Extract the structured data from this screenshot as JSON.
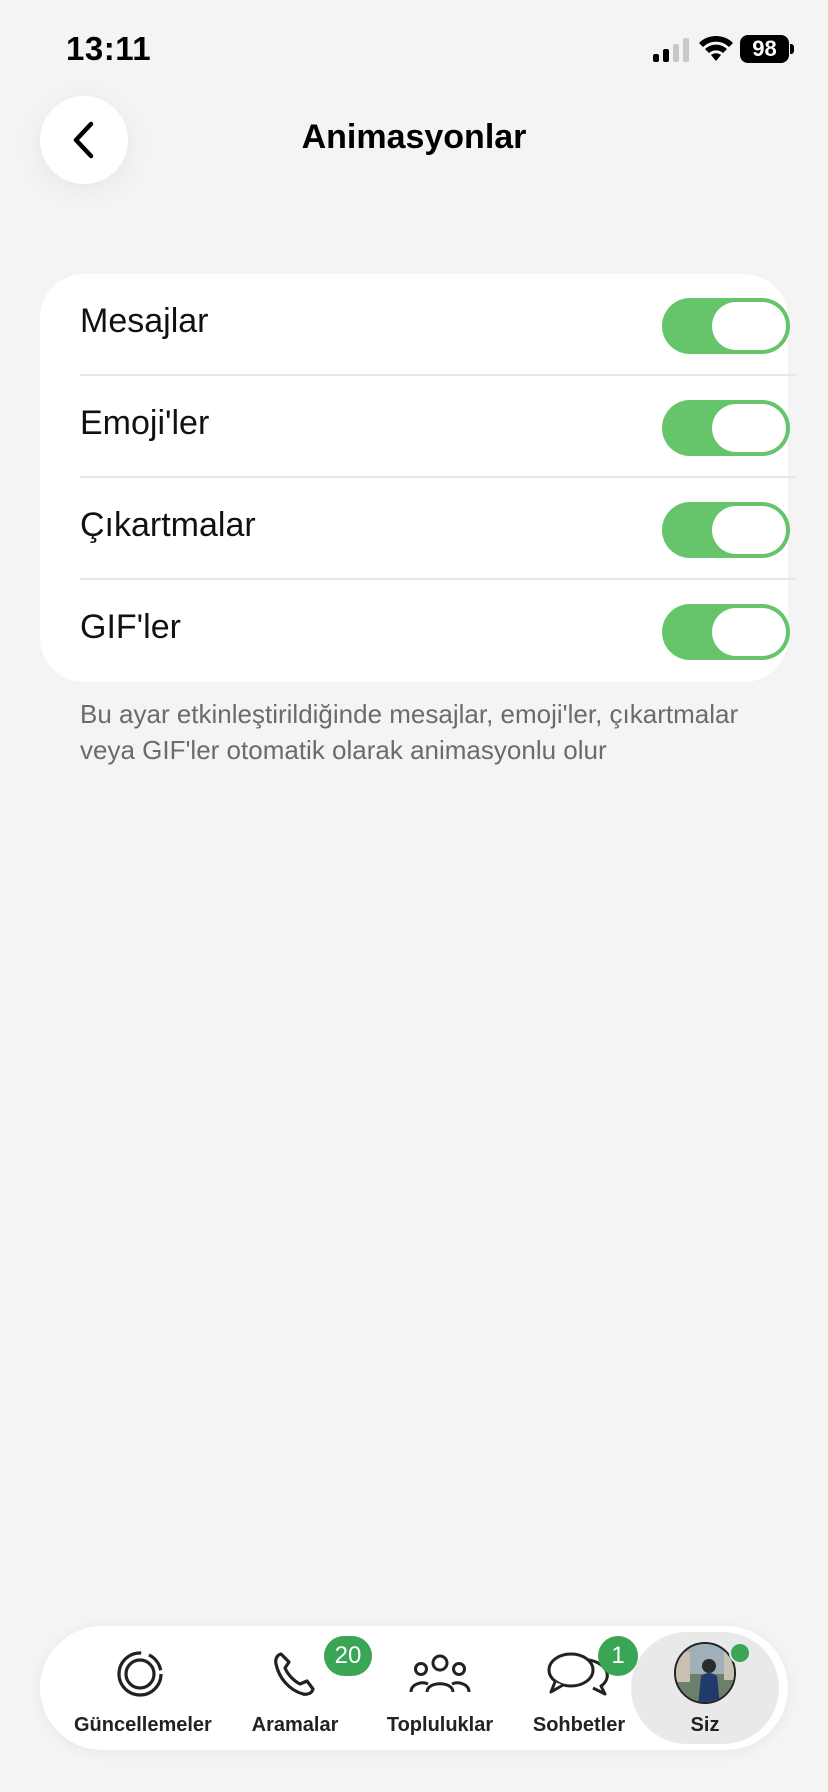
{
  "status_bar": {
    "time": "13:11",
    "battery": "98"
  },
  "header": {
    "title": "Animasyonlar",
    "back_icon": "chevron-left-icon"
  },
  "settings": {
    "rows": [
      {
        "label": "Mesajlar",
        "enabled": true
      },
      {
        "label": "Emoji'ler",
        "enabled": true
      },
      {
        "label": "Çıkartmalar",
        "enabled": true
      },
      {
        "label": "GIF'ler",
        "enabled": true
      }
    ],
    "footnote": "Bu ayar etkinleştirildiğinde mesajlar, emoji'ler, çıkartmalar veya GIF'ler otomatik olarak animasyonlu olur"
  },
  "tab_bar": {
    "tabs": [
      {
        "label": "Güncellemeler",
        "icon": "status-updates-icon"
      },
      {
        "label": "Aramalar",
        "icon": "phone-icon",
        "badge": "20"
      },
      {
        "label": "Topluluklar",
        "icon": "communities-icon"
      },
      {
        "label": "Sohbetler",
        "icon": "chats-icon",
        "badge": "1"
      },
      {
        "label": "Siz",
        "icon": "avatar",
        "active": true
      }
    ]
  },
  "colors": {
    "toggle_on": "#66c56a",
    "badge": "#3aa655",
    "background": "#f4f4f4"
  }
}
